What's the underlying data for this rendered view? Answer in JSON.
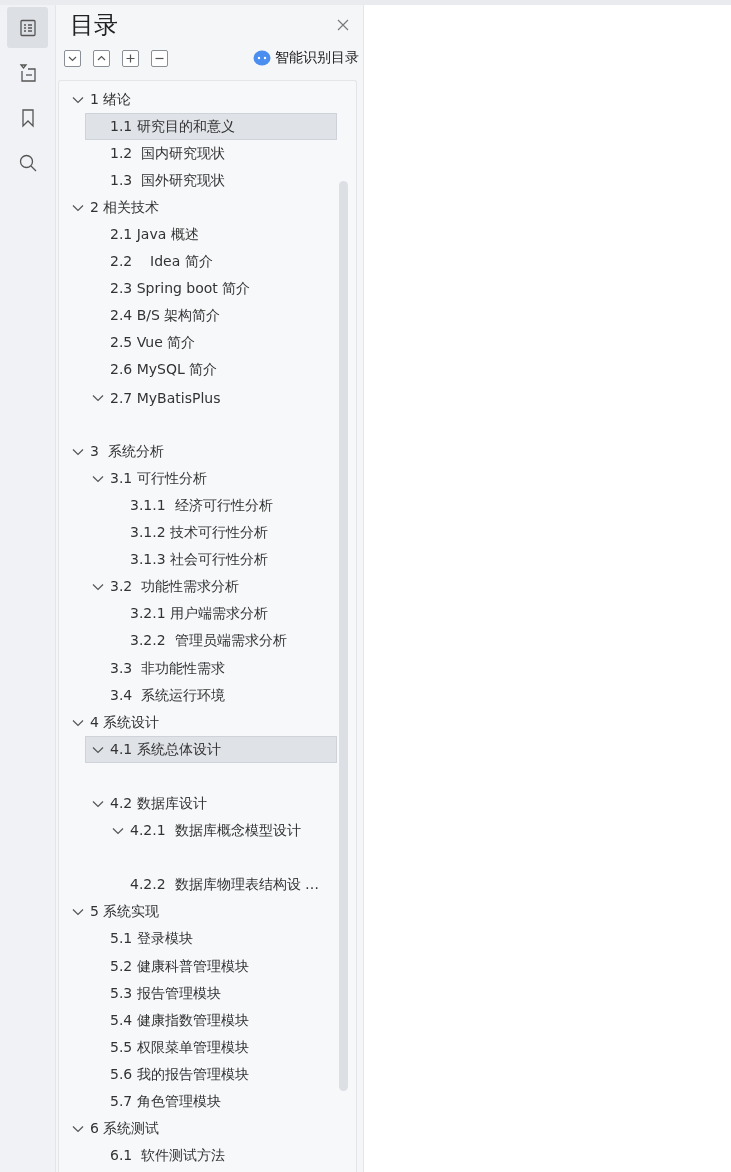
{
  "sidebar": {
    "items": [
      {
        "selected": true
      },
      {
        "selected": false
      },
      {
        "selected": false
      },
      {
        "selected": false
      }
    ]
  },
  "panel": {
    "title": "目录",
    "smart_button": "智能识别目录"
  },
  "tree": [
    {
      "title": "1 绪论",
      "expanded": true,
      "selected": false,
      "children": [
        {
          "title": "1.1 研究目的和意义",
          "selected": true
        },
        {
          "title": "1.2  国内研究现状",
          "selected": false
        },
        {
          "title": "1.3  国外研究现状",
          "selected": false
        }
      ]
    },
    {
      "title": "2 相关技术",
      "expanded": true,
      "selected": false,
      "children": [
        {
          "title": "2.1 Java 概述",
          "selected": false
        },
        {
          "title": "2.2    Idea 简介",
          "selected": false
        },
        {
          "title": "2.3 Spring boot 简介",
          "selected": false
        },
        {
          "title": "2.4 B/S 架构简介",
          "selected": false
        },
        {
          "title": "2.5 Vue 简介",
          "selected": false
        },
        {
          "title": "2.6 MySQL 简介",
          "selected": false
        },
        {
          "title": "2.7 MyBatisPlus",
          "expanded": true,
          "selected": false,
          "children": [
            {
              "kind": "blank"
            }
          ]
        }
      ]
    },
    {
      "title": "3  系统分析",
      "expanded": true,
      "selected": false,
      "children": [
        {
          "title": "3.1 可行性分析",
          "expanded": true,
          "selected": false,
          "children": [
            {
              "title": "3.1.1  经济可行性分析",
              "selected": false
            },
            {
              "title": "3.1.2 技术可行性分析",
              "selected": false
            },
            {
              "title": "3.1.3 社会可行性分析",
              "selected": false
            }
          ]
        },
        {
          "title": "3.2  功能性需求分析",
          "expanded": true,
          "selected": false,
          "children": [
            {
              "title": "3.2.1 用户端需求分析",
              "selected": false
            },
            {
              "title": "3.2.2  管理员端需求分析",
              "selected": false
            }
          ]
        },
        {
          "title": "3.3  非功能性需求",
          "selected": false
        },
        {
          "title": "3.4  系统运行环境",
          "selected": false
        }
      ]
    },
    {
      "title": "4 系统设计",
      "expanded": true,
      "selected": false,
      "children": [
        {
          "title": "4.1 系统总体设计",
          "expanded": true,
          "selected": true,
          "children": [
            {
              "kind": "blank"
            }
          ]
        },
        {
          "title": "4.2 数据库设计",
          "expanded": true,
          "selected": false,
          "children": [
            {
              "title": "4.2.1  数据库概念模型设计",
              "expanded": true,
              "selected": false,
              "children": [
                {
                  "kind": "blank"
                }
              ]
            },
            {
              "title": "4.2.2  数据库物理表结构设 …",
              "selected": false
            }
          ]
        }
      ]
    },
    {
      "title": "5 系统实现",
      "expanded": true,
      "selected": false,
      "children": [
        {
          "title": "5.1 登录模块",
          "selected": false
        },
        {
          "title": "5.2 健康科普管理模块",
          "selected": false
        },
        {
          "title": "5.3 报告管理模块",
          "selected": false
        },
        {
          "title": "5.4 健康指数管理模块",
          "selected": false
        },
        {
          "title": "5.5 权限菜单管理模块",
          "selected": false
        },
        {
          "title": "5.6 我的报告管理模块",
          "selected": false
        },
        {
          "title": "5.7 角色管理模块",
          "selected": false
        }
      ]
    },
    {
      "title": "6 系统测试",
      "expanded": true,
      "selected": false,
      "children": [
        {
          "title": "6.1  软件测试方法",
          "selected": false
        }
      ]
    }
  ]
}
